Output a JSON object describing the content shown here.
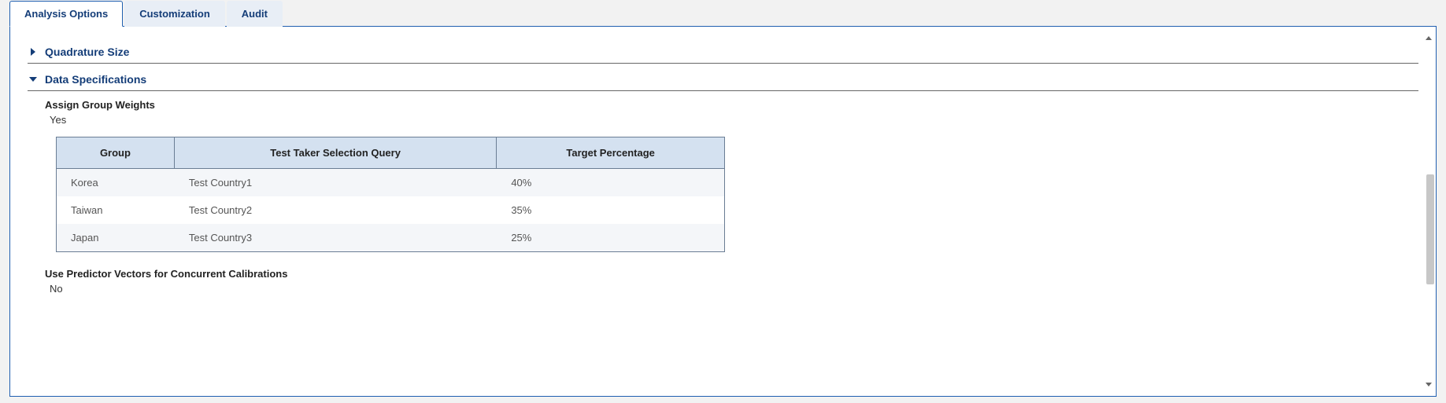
{
  "tabs": [
    {
      "label": "Analysis Options",
      "active": true
    },
    {
      "label": "Customization",
      "active": false
    },
    {
      "label": "Audit",
      "active": false
    }
  ],
  "sections": {
    "quadrature": {
      "title": "Quadrature Size",
      "expanded": false
    },
    "dataSpec": {
      "title": "Data Specifications",
      "expanded": true,
      "assignGroupWeights": {
        "label": "Assign Group Weights",
        "value": "Yes"
      },
      "table": {
        "headers": {
          "group": "Group",
          "query": "Test Taker Selection Query",
          "target": "Target Percentage"
        },
        "rows": [
          {
            "group": "Korea",
            "query": "Test Country1",
            "target": "40%"
          },
          {
            "group": "Taiwan",
            "query": "Test Country2",
            "target": "35%"
          },
          {
            "group": "Japan",
            "query": "Test Country3",
            "target": "25%"
          }
        ]
      },
      "predictorVectors": {
        "label": "Use Predictor Vectors for Concurrent Calibrations",
        "value": "No"
      }
    }
  }
}
